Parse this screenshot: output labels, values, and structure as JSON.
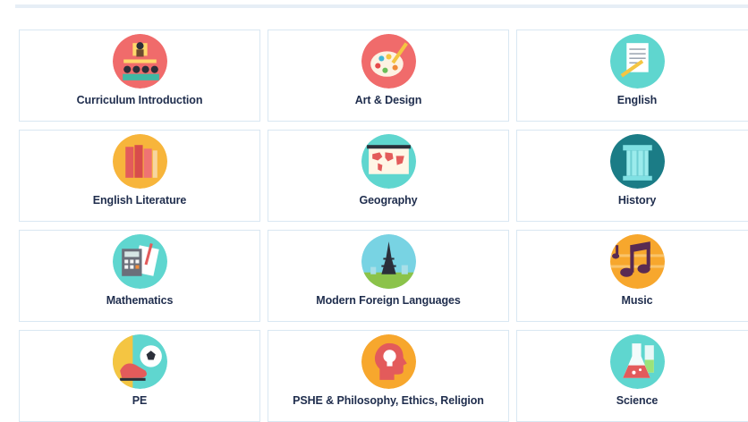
{
  "subjects": [
    {
      "label": "Curriculum Introduction",
      "icon": "classroom-teacher-icon",
      "color": "#f06b6b"
    },
    {
      "label": "Art & Design",
      "icon": "paint-palette-icon",
      "color": "#f06b6b"
    },
    {
      "label": "English",
      "icon": "paper-pencil-icon",
      "color": "#5fd6cf"
    },
    {
      "label": "English Literature",
      "icon": "books-icon",
      "color": "#f7b53b"
    },
    {
      "label": "Geography",
      "icon": "world-map-icon",
      "color": "#5fd6cf"
    },
    {
      "label": "History",
      "icon": "column-icon",
      "color": "#1b7c86"
    },
    {
      "label": "Mathematics",
      "icon": "calculator-icon",
      "color": "#5fd6cf"
    },
    {
      "label": "Modern Foreign Languages",
      "icon": "eiffel-tower-icon",
      "color": "#78d3e3"
    },
    {
      "label": "Music",
      "icon": "music-notes-icon",
      "color": "#f7a72d"
    },
    {
      "label": "PE",
      "icon": "football-boot-icon",
      "color": "#5fd6cf"
    },
    {
      "label": "PSHE & Philosophy, Ethics, Religion",
      "icon": "head-lightbulb-icon",
      "color": "#f7a72d"
    },
    {
      "label": "Science",
      "icon": "flask-icon",
      "color": "#5fd6cf"
    }
  ]
}
